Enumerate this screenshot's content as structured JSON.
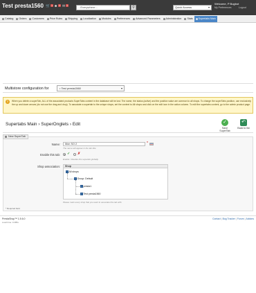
{
  "header": {
    "shop_title": "Test presta1560",
    "notifications": [
      {
        "icon": "cart-icon",
        "count": "1"
      },
      {
        "icon": "user-icon",
        "count": "2"
      },
      {
        "icon": "message-icon",
        "count": "1"
      }
    ],
    "search_value": "...Everywhere...",
    "search_button_icon": "search-icon",
    "quick_access_label": "Quick Access",
    "welcome_text": "Welcome, P Bugbot",
    "my_preferences": "My Preferences",
    "logout": "Logout"
  },
  "menu": {
    "items": [
      {
        "label": "Catalog",
        "icon": "catalog-icon"
      },
      {
        "label": "Orders",
        "icon": "orders-icon"
      },
      {
        "label": "Customers",
        "icon": "customers-icon"
      },
      {
        "label": "Price Rules",
        "icon": "price-rules-icon"
      },
      {
        "label": "Shipping",
        "icon": "shipping-icon"
      },
      {
        "label": "Localization",
        "icon": "localization-icon"
      },
      {
        "label": "Modules",
        "icon": "modules-icon"
      },
      {
        "label": "Preferences",
        "icon": "preferences-icon"
      },
      {
        "label": "Advanced Parameters",
        "icon": "advanced-icon"
      },
      {
        "label": "Administration",
        "icon": "administration-icon"
      },
      {
        "label": "Stats",
        "icon": "stats-icon"
      },
      {
        "label": "Supertabs Main",
        "icon": "supertabs-icon",
        "active": true
      }
    ]
  },
  "multistore": {
    "label": "Multistore configuration for",
    "selected": "• Test presta1560"
  },
  "warning": {
    "text": "When you delete a superTab, ALL of the associated products SuperTabs content in the database will be lost. The name, the status (active) and the position value are common to all shops. To change the superTabs position, use exclusively the up and down arrows (do not use the drag and drop). To associate a supertab to the unique shops, set the context to All shops and click on the edit icon in the action column. To edit the supertabs content, go to the admin product page."
  },
  "toolbar": {
    "breadcrumb": "Supertabs Main  ›  SuperOnglets  ›  Edit",
    "save_label": "Save SuperTab",
    "back_label": "Back to list"
  },
  "form": {
    "legend": "New SuperTab",
    "name_label": "Name:",
    "name_value": "Mon SO 2",
    "name_hint": "The name will appear in the tab title.",
    "enable_label": "Enable this tab:",
    "enable_hint": "Enable / Disable this supertab globally.",
    "shop_assoc_label": "Shop association:",
    "tree_header": "Shop",
    "tree": {
      "all_shops": "All shops",
      "group": "Group: Default",
      "shop1": "presta1",
      "shop2": "Test presta1560"
    },
    "tree_hint": "Please mark every shop that you want to associate this tab with.",
    "required_note": "* Required field"
  },
  "footer": {
    "version": "PrestaShop™ 1.5.6.0",
    "load_time": "Load time: 0.385s",
    "links": [
      "Contact",
      "Bug Tracker",
      "Forum",
      "Addons"
    ]
  },
  "colors": {
    "header_bg": "#3a3a3a",
    "active_tab": "#4a86c7",
    "warning_bg": "#fff6c9",
    "save_green": "#4caf50"
  }
}
